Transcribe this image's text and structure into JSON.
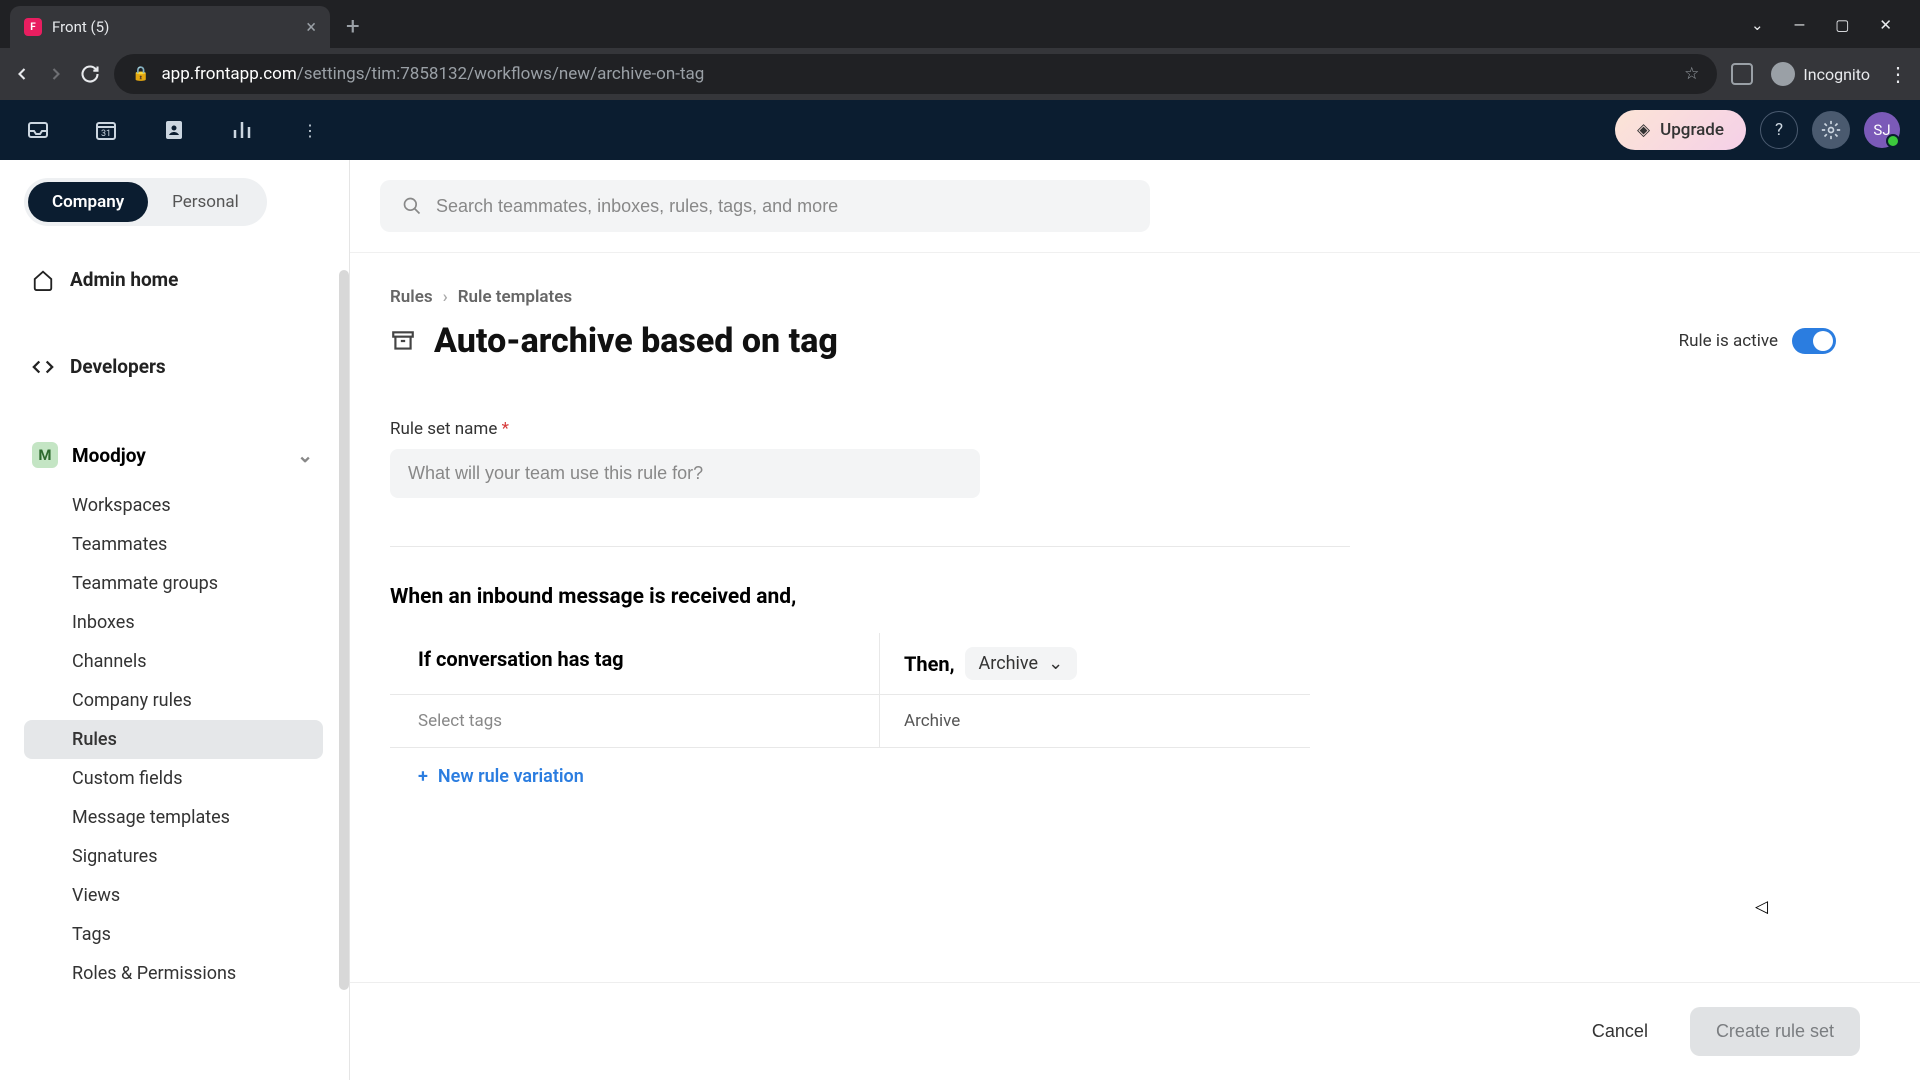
{
  "browser": {
    "tab_title": "Front (5)",
    "url_host": "app.frontapp.com",
    "url_path": "/settings/tim:7858132/workflows/new/archive-on-tag",
    "incognito_label": "Incognito"
  },
  "header": {
    "upgrade_label": "Upgrade",
    "avatar_initials": "SJ"
  },
  "sidebar": {
    "scope": {
      "company": "Company",
      "personal": "Personal"
    },
    "admin_home": "Admin home",
    "developers": "Developers",
    "workspace": {
      "badge": "M",
      "name": "Moodjoy"
    },
    "children": [
      "Workspaces",
      "Teammates",
      "Teammate groups",
      "Inboxes",
      "Channels",
      "Company rules",
      "Rules",
      "Custom fields",
      "Message templates",
      "Signatures",
      "Views",
      "Tags",
      "Roles & Permissions"
    ],
    "active_index": 6
  },
  "search": {
    "placeholder": "Search teammates, inboxes, rules, tags, and more"
  },
  "breadcrumb": {
    "rules": "Rules",
    "templates": "Rule templates"
  },
  "page": {
    "title": "Auto-archive based on tag",
    "active_label": "Rule is active"
  },
  "form": {
    "name_label": "Rule set name",
    "name_placeholder": "What will your team use this rule for?",
    "when_heading": "When an inbound message is received and,",
    "if_heading": "If conversation has tag",
    "then_heading": "Then,",
    "action_chip": "Archive",
    "select_tags_placeholder": "Select tags",
    "action_value": "Archive",
    "new_variation": "New rule variation"
  },
  "footer": {
    "cancel": "Cancel",
    "create": "Create rule set"
  }
}
